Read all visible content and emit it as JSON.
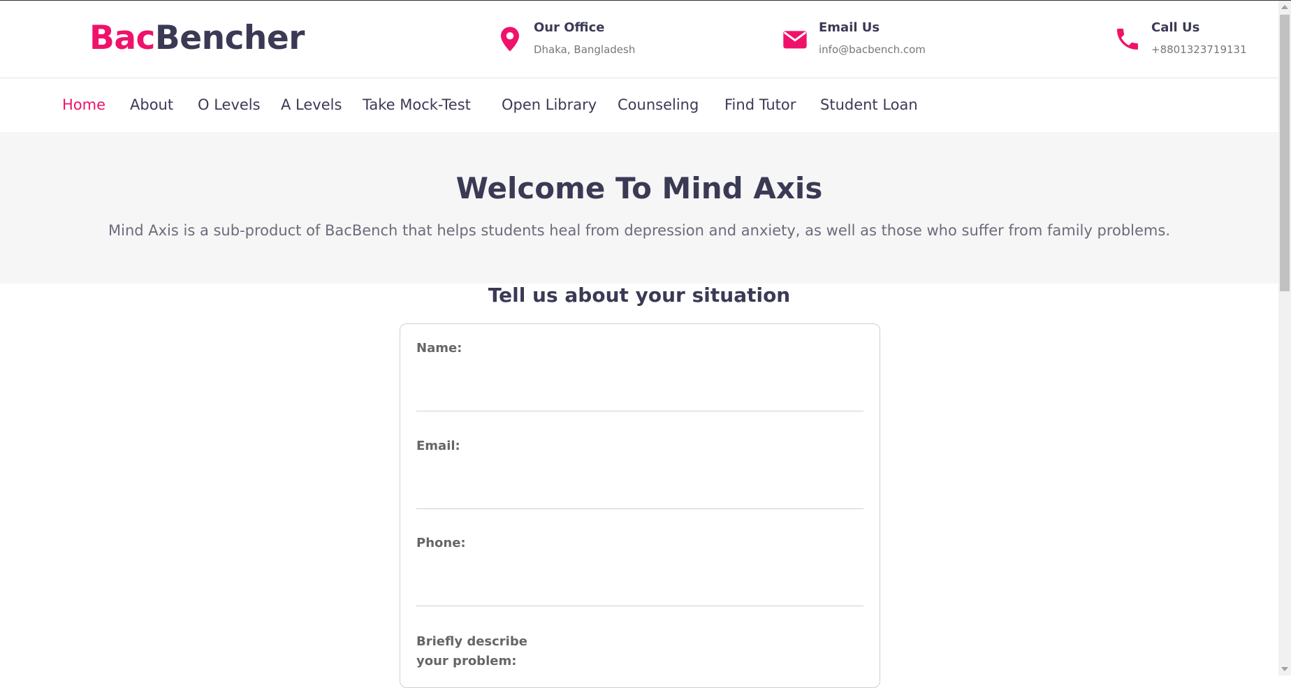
{
  "brand": {
    "logo_part1": "Bac",
    "logo_part2": "Bencher",
    "accent_color": "#f0126a",
    "text_color": "#3b3a55"
  },
  "contacts": [
    {
      "icon": "map-pin-icon",
      "title": "Our Office",
      "value": "Dhaka, Bangladesh"
    },
    {
      "icon": "envelope-icon",
      "title": "Email Us",
      "value": "info@bacbench.com"
    },
    {
      "icon": "phone-icon",
      "title": "Call Us",
      "value": "+8801323719131"
    }
  ],
  "nav": {
    "active": "Home",
    "items": [
      "Home",
      "About",
      "O Levels",
      "A Levels",
      "Take Mock-Test",
      "Open Library",
      "Counseling",
      "Find Tutor",
      "Student Loan"
    ]
  },
  "hero": {
    "title": "Welcome To Mind Axis",
    "description": "Mind Axis is a sub-product of BacBench that helps students heal from depression and anxiety, as well as those who suffer from family problems."
  },
  "form": {
    "heading": "Tell us about your situation",
    "name_label": "Name:",
    "email_label": "Email:",
    "phone_label": "Phone:",
    "problem_label_line1": "Briefly describe",
    "problem_label_line2": "your problem:"
  }
}
